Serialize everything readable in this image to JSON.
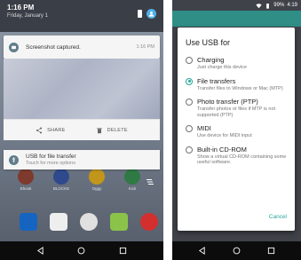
{
  "left": {
    "shade": {
      "time": "1:16 PM",
      "date": "Friday, January 1"
    },
    "screenshot_notif": {
      "title": "Screenshot captured.",
      "time": "1:16 PM",
      "share_label": "SHARE",
      "delete_label": "DELETE"
    },
    "usb_notif": {
      "title": "USB for file transfer",
      "subtitle": "Touch for more options"
    },
    "apps": [
      {
        "label": "Ebook",
        "color": "#7e3a2c"
      },
      {
        "label": "BLOCKE",
        "color": "#2e4a8c"
      },
      {
        "label": "Oggy",
        "color": "#c2961b"
      },
      {
        "label": "Kick",
        "color": "#2f7a44"
      }
    ],
    "dock_colors": [
      "#1565c0",
      "#eeeeee",
      "#e0e0e0",
      "#8bc34a",
      "#d32f2f"
    ]
  },
  "right": {
    "status": {
      "battery": "99%",
      "time": "4:19"
    },
    "dialog": {
      "title": "Use USB for",
      "options": [
        {
          "label": "Charging",
          "desc": "Just charge this device",
          "checked": false
        },
        {
          "label": "File transfers",
          "desc": "Transfer files to Windows or Mac (MTP)",
          "checked": true
        },
        {
          "label": "Photo transfer (PTP)",
          "desc": "Transfer photos or files if MTP is not supported (PTP)",
          "checked": false
        },
        {
          "label": "MIDI",
          "desc": "Use device for MIDI input",
          "checked": false
        },
        {
          "label": "Built-in CD-ROM",
          "desc": "Show a virtual CD-ROM containing some useful software.",
          "checked": false
        }
      ],
      "cancel_label": "Cancel"
    }
  },
  "colors": {
    "accent": "#26a69a",
    "nav_bar": "#0c0c0c"
  }
}
